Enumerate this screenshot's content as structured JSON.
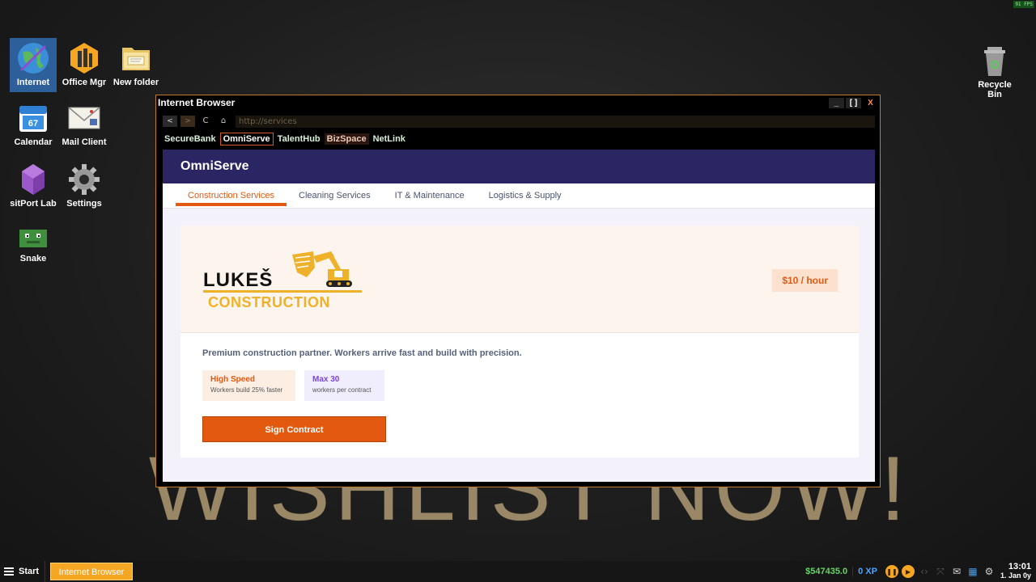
{
  "fps": "91 FPS",
  "wallpaper_text": "WISHLIST NOW!",
  "desktop_icons": [
    {
      "label": "Internet",
      "icon": "globe-icon"
    },
    {
      "label": "Office Mgr",
      "icon": "office-building-icon"
    },
    {
      "label": "New folder",
      "icon": "folder-icon"
    },
    {
      "label": "Calendar",
      "icon": "calendar-icon"
    },
    {
      "label": "Mail Client",
      "icon": "mail-icon"
    },
    {
      "label": "sitPort Lab",
      "icon": "crystal-icon"
    },
    {
      "label": "Settings",
      "icon": "gear-icon"
    },
    {
      "label": "Snake",
      "icon": "snake-icon"
    },
    {
      "label": "Recycle Bin",
      "icon": "trash-icon"
    }
  ],
  "calendar_icon_day": "67",
  "browser": {
    "title": "Internet Browser",
    "buttons": {
      "minimize": "_",
      "maximize": "[ ]",
      "close": "X"
    },
    "nav": {
      "back": "<",
      "forward": ">",
      "reload": "C",
      "home": "⌂"
    },
    "url_placeholder": "http://services",
    "bookmarks": [
      "SecureBank",
      "OmniServe",
      "TalentHub",
      "BizSpace",
      "NetLink"
    ],
    "active_bookmark": "OmniServe"
  },
  "site": {
    "brand": "OmniServe",
    "tabs": [
      "Construction Services",
      "Cleaning Services",
      "IT & Maintenance",
      "Logistics & Supply"
    ],
    "active_tab": "Construction Services",
    "listing": {
      "logo_line1": "LUKEŠ",
      "logo_line2": "CONSTRUCTION",
      "price": "$10 / hour",
      "description": "Premium construction partner. Workers arrive fast and build with precision.",
      "badge_speed_title": "High Speed",
      "badge_speed_sub": "Workers build 25% faster",
      "badge_max_title": "Max 30",
      "badge_max_sub": "workers per contract",
      "sign_button": "Sign Contract"
    }
  },
  "taskbar": {
    "start_label": "Start",
    "task": "Internet Browser",
    "money": "$547435.0",
    "xp": "0 XP",
    "time": "13:01",
    "date": "1. Jan 0y"
  },
  "colors": {
    "accent_orange": "#e2590f",
    "site_header": "#2b2563",
    "window_border": "#c07a2c",
    "money_green": "#69d26a",
    "xp_blue": "#4aa3ff"
  }
}
